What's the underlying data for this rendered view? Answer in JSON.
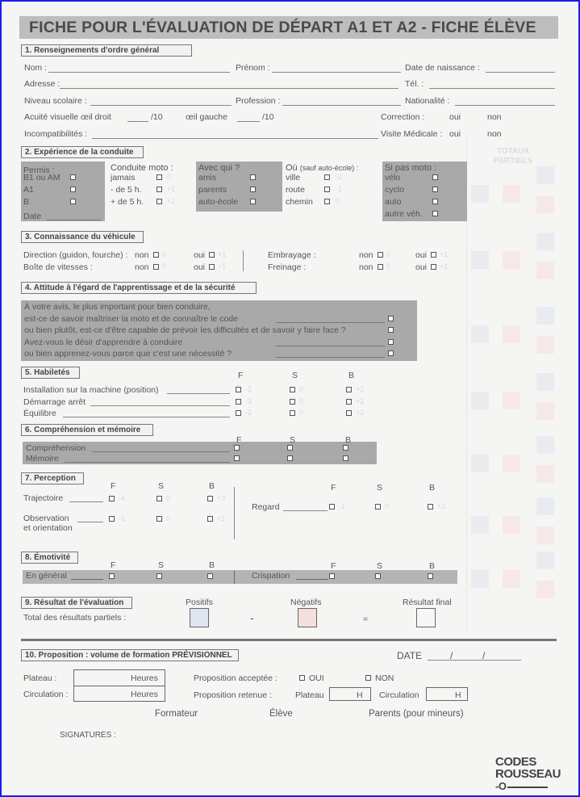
{
  "title": "FICHE POUR L'ÉVALUATION DE DÉPART A1 ET A2 - FICHE ÉLÈVE",
  "totals_header": "TOTAUX PARTIELS",
  "s1": {
    "header": "1. Renseignements d'ordre général",
    "nom": "Nom :",
    "prenom": "Prénom :",
    "naissance": "Date de naissance :",
    "adresse": "Adresse :",
    "tel": "Tél. :",
    "niveau": "Niveau scolaire :",
    "profession": "Profession :",
    "nationalite": "Nationalité :",
    "acuite": "Acuité visuelle œil droit",
    "sur10": "/10",
    "gauche": "œil gauche",
    "sur10b": "/10",
    "correction": "Correction :",
    "oui": "oui",
    "non": "non",
    "incompat": "Incompatibilités :",
    "visite": "Visite Médicale :",
    "oui2": "oui",
    "non2": "non"
  },
  "s2": {
    "header": "2. Expérience de la conduite",
    "permis": {
      "label": "Permis :",
      "items": [
        "B1 ou AM",
        "A1",
        "B"
      ],
      "date": "Date"
    },
    "moto": {
      "label": "Conduite moto :",
      "items": [
        "jamais",
        "- de 5 h.",
        "+ de 5 h."
      ],
      "scores": [
        "0",
        "+1",
        "+2"
      ]
    },
    "avec": {
      "label": "Avec qui ?",
      "items": [
        "amis",
        "parents",
        "auto-école"
      ]
    },
    "ou": {
      "label": "Où",
      "note": "(sauf auto-école) :",
      "items": [
        "ville",
        "route",
        "chemin"
      ],
      "scores": [
        "-2",
        "-1",
        "0"
      ]
    },
    "pasmoto": {
      "label": "Si pas moto :",
      "items": [
        "vélo",
        "cyclo",
        "auto",
        "autre véh."
      ]
    }
  },
  "s3": {
    "header": "3. Connaissance du véhicule",
    "rows": [
      {
        "label": "Direction (guidon, fourche) :",
        "non": "non",
        "oui": "oui",
        "s0": "0",
        "s1": "+1"
      },
      {
        "label": "Boîte de vitesses :",
        "non": "non",
        "oui": "oui",
        "s0": "0",
        "s1": "+1"
      },
      {
        "label": "Embrayage :",
        "non": "non",
        "oui": "oui",
        "s0": "0",
        "s1": "+1"
      },
      {
        "label": "Freinage :",
        "non": "non",
        "oui": "oui",
        "s0": "0",
        "s1": "+1"
      }
    ]
  },
  "s4": {
    "header": "4. Attitude à l'égard de l'apprentissage et de la sécurité",
    "lines": [
      "À votre avis, le plus important pour bien conduire,",
      "est-ce de savoir maîtriser la moto et de connaître le code",
      "ou bien plutôt, est-ce d'être capable de prévoir les difficultés et de savoir y faire face ?",
      "Avez-vous le désir d'apprendre à conduire",
      "ou bien apprenez-vous parce que c'est une nécessité ?"
    ]
  },
  "cols": {
    "f": "F",
    "s": "S",
    "b": "B"
  },
  "s5": {
    "header": "5. Habiletés",
    "rows": [
      {
        "label": "Installation sur la machine (position)",
        "scores": [
          "-2",
          "0",
          "+2"
        ]
      },
      {
        "label": "Démarrage arrêt",
        "scores": [
          "-3",
          "0",
          "+2"
        ]
      },
      {
        "label": "Équilibre",
        "scores": [
          "-2",
          "0",
          "+2"
        ]
      }
    ]
  },
  "s6": {
    "header": "6. Compréhension et mémoire",
    "rows": [
      "Compréhension",
      "Mémoire"
    ]
  },
  "s7": {
    "header": "7. Perception",
    "trajectoire": "Trajectoire",
    "traj_scores": [
      "-4",
      "0",
      "+3"
    ],
    "observation": "Observation",
    "orientation": "et orientation",
    "obs_scores": [
      "-1",
      "0",
      "+1"
    ],
    "regard": "Regard",
    "regard_scores": [
      "-1",
      "0",
      "+2"
    ]
  },
  "s8": {
    "header": "8. Émotivité",
    "general": "En général",
    "crispation": "Crispation"
  },
  "s9": {
    "header": "9. Résultat de l'évaluation",
    "total": "Total des résultats partiels :",
    "positifs": "Positifs",
    "negatifs": "Négatifs",
    "final": "Résultat final",
    "minus": "-",
    "equals": "="
  },
  "s10": {
    "header": "10. Proposition : volume de formation PRÉVISIONNEL",
    "date": "DATE",
    "plateau": "Plateau :",
    "circulation": "Circulation :",
    "heures": "Heures",
    "acceptee": "Proposition acceptée :",
    "oui": "OUI",
    "non": "NON",
    "retenue": "Proposition retenue :",
    "plateau2": "Plateau",
    "circulation2": "Circulation",
    "h": "H",
    "formateur": "Formateur",
    "eleve": "Élève",
    "parents": "Parents (pour mineurs)",
    "signatures": "SIGNATURES :"
  },
  "logo": {
    "line1": "CODES",
    "line2": "ROUSSEAU"
  },
  "colors": {
    "positive_box": "#dfe6f0",
    "negative_box": "#f5dede",
    "band": "#a9a9a9",
    "frame": "#1d1df0"
  }
}
